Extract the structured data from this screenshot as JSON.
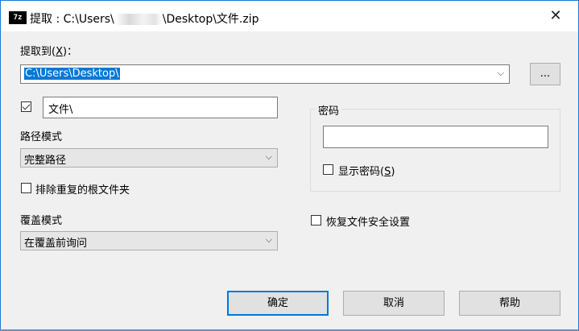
{
  "window": {
    "title_prefix": "提取 : C:\\Users\\",
    "title_suffix": "\\Desktop\\文件.zip",
    "icon_text": "7z",
    "close_glyph": "✕"
  },
  "extract_to": {
    "label_main": "提取到(",
    "label_hotkey": "X",
    "label_end": ")：",
    "value": "C:\\Users\\Desktop\\",
    "browse_label": "..."
  },
  "subfolder": {
    "checked": true,
    "value": "文件\\"
  },
  "path_mode": {
    "label": "路径模式",
    "selected": "完整路径"
  },
  "exclude_root": {
    "label": "排除重复的根文件夹",
    "checked": false
  },
  "overwrite_mode": {
    "label": "覆盖模式",
    "selected": "在覆盖前询问"
  },
  "password": {
    "group_label": "密码",
    "value": "",
    "show_label_main": "显示密码(",
    "show_label_hotkey": "S",
    "show_label_end": ")",
    "show_checked": false
  },
  "restore_security": {
    "label": "恢复文件安全设置",
    "checked": false
  },
  "buttons": {
    "ok": "确定",
    "cancel": "取消",
    "help": "帮助"
  },
  "dropdown_glyph": "⌵",
  "colors": {
    "accent": "#0078d7",
    "window_border": "#1b78d0"
  }
}
